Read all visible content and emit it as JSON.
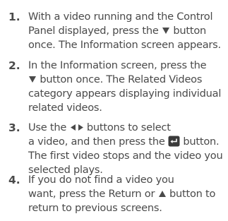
{
  "steps": [
    {
      "number": "1.",
      "lines": [
        {
          "text": "With a video running and the Control"
        },
        {
          "text": "Panel displayed, press the",
          "icon": "down-triangle-icon",
          "after": "button"
        },
        {
          "text": "once. The Information screen appears."
        }
      ]
    },
    {
      "number": "2.",
      "lines": [
        {
          "text": "In the Information screen, press the"
        },
        {
          "icon": "down-triangle-icon",
          "after": "button once. The Related Videos"
        },
        {
          "text": "category appears displaying individual"
        },
        {
          "text": "related videos."
        }
      ]
    },
    {
      "number": "3.",
      "lines": [
        {
          "text": "Use the",
          "icon": "left-right-arrows-icon",
          "after": "buttons to select"
        },
        {
          "text": "a video, and then press the",
          "icon": "enter-button-icon",
          "after": "button."
        },
        {
          "text": "The first video stops and the video you"
        },
        {
          "text": "selected plays."
        }
      ]
    },
    {
      "number": "4.",
      "lines": [
        {
          "text": "If you do not find a video you"
        },
        {
          "text": "want, press the Return or",
          "icon": "up-triangle-icon",
          "after": "button to"
        },
        {
          "text": "return to previous screens."
        }
      ]
    }
  ]
}
